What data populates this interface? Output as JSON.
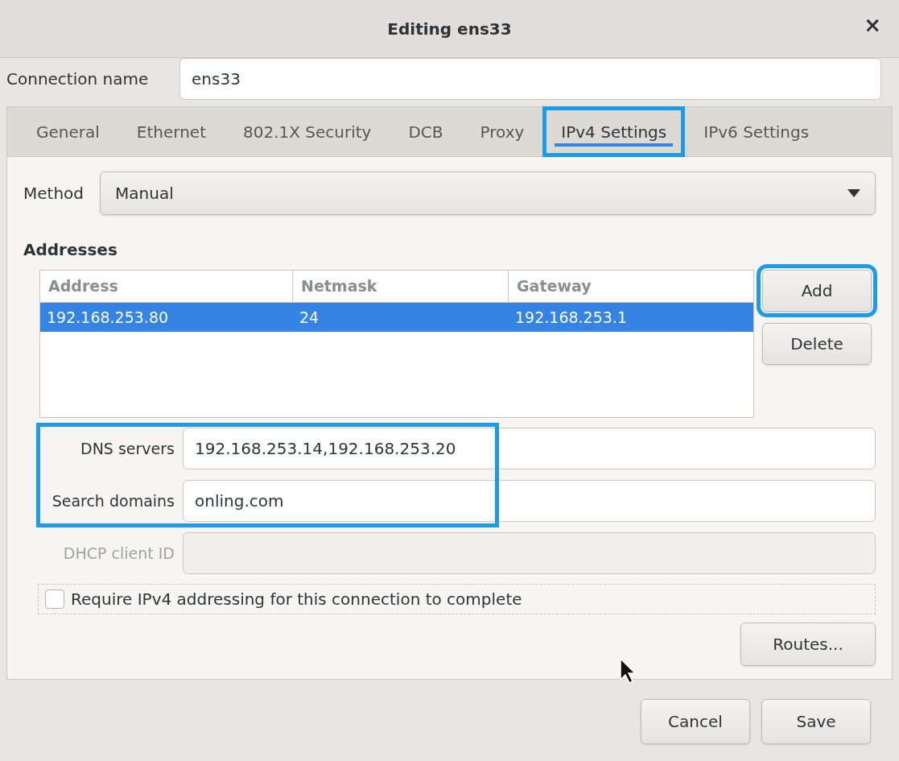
{
  "window": {
    "title": "Editing ens33",
    "close": "×"
  },
  "connection_name": {
    "label": "Connection name",
    "value": "ens33"
  },
  "tabs": [
    {
      "label": "General",
      "selected": false,
      "highlighted": false
    },
    {
      "label": "Ethernet",
      "selected": false,
      "highlighted": false
    },
    {
      "label": "802.1X Security",
      "selected": false,
      "highlighted": false
    },
    {
      "label": "DCB",
      "selected": false,
      "highlighted": false
    },
    {
      "label": "Proxy",
      "selected": false,
      "highlighted": false
    },
    {
      "label": "IPv4 Settings",
      "selected": true,
      "highlighted": true
    },
    {
      "label": "IPv6 Settings",
      "selected": false,
      "highlighted": false
    }
  ],
  "method": {
    "label": "Method",
    "value": "Manual"
  },
  "addresses": {
    "title": "Addresses",
    "columns": [
      "Address",
      "Netmask",
      "Gateway"
    ],
    "rows": [
      {
        "cells": [
          "192.168.253.80",
          "24",
          "192.168.253.1"
        ],
        "selected": true
      }
    ],
    "buttons": [
      {
        "label": "Add",
        "highlighted": true
      },
      {
        "label": "Delete",
        "highlighted": false
      }
    ]
  },
  "fields": [
    {
      "label": "DNS servers",
      "value": "192.168.253.14,192.168.253.20",
      "disabled": false,
      "highlighted": true
    },
    {
      "label": "Search domains",
      "value": "onling.com",
      "disabled": false,
      "highlighted": true
    },
    {
      "label": "DHCP client ID",
      "disabled": true,
      "highlighted": false
    }
  ],
  "require_checkbox": {
    "label": "Require IPv4 addressing for this connection to complete",
    "checked": false
  },
  "routes_button": "Routes...",
  "footer_buttons": [
    {
      "label": "Cancel"
    },
    {
      "label": "Save"
    }
  ]
}
